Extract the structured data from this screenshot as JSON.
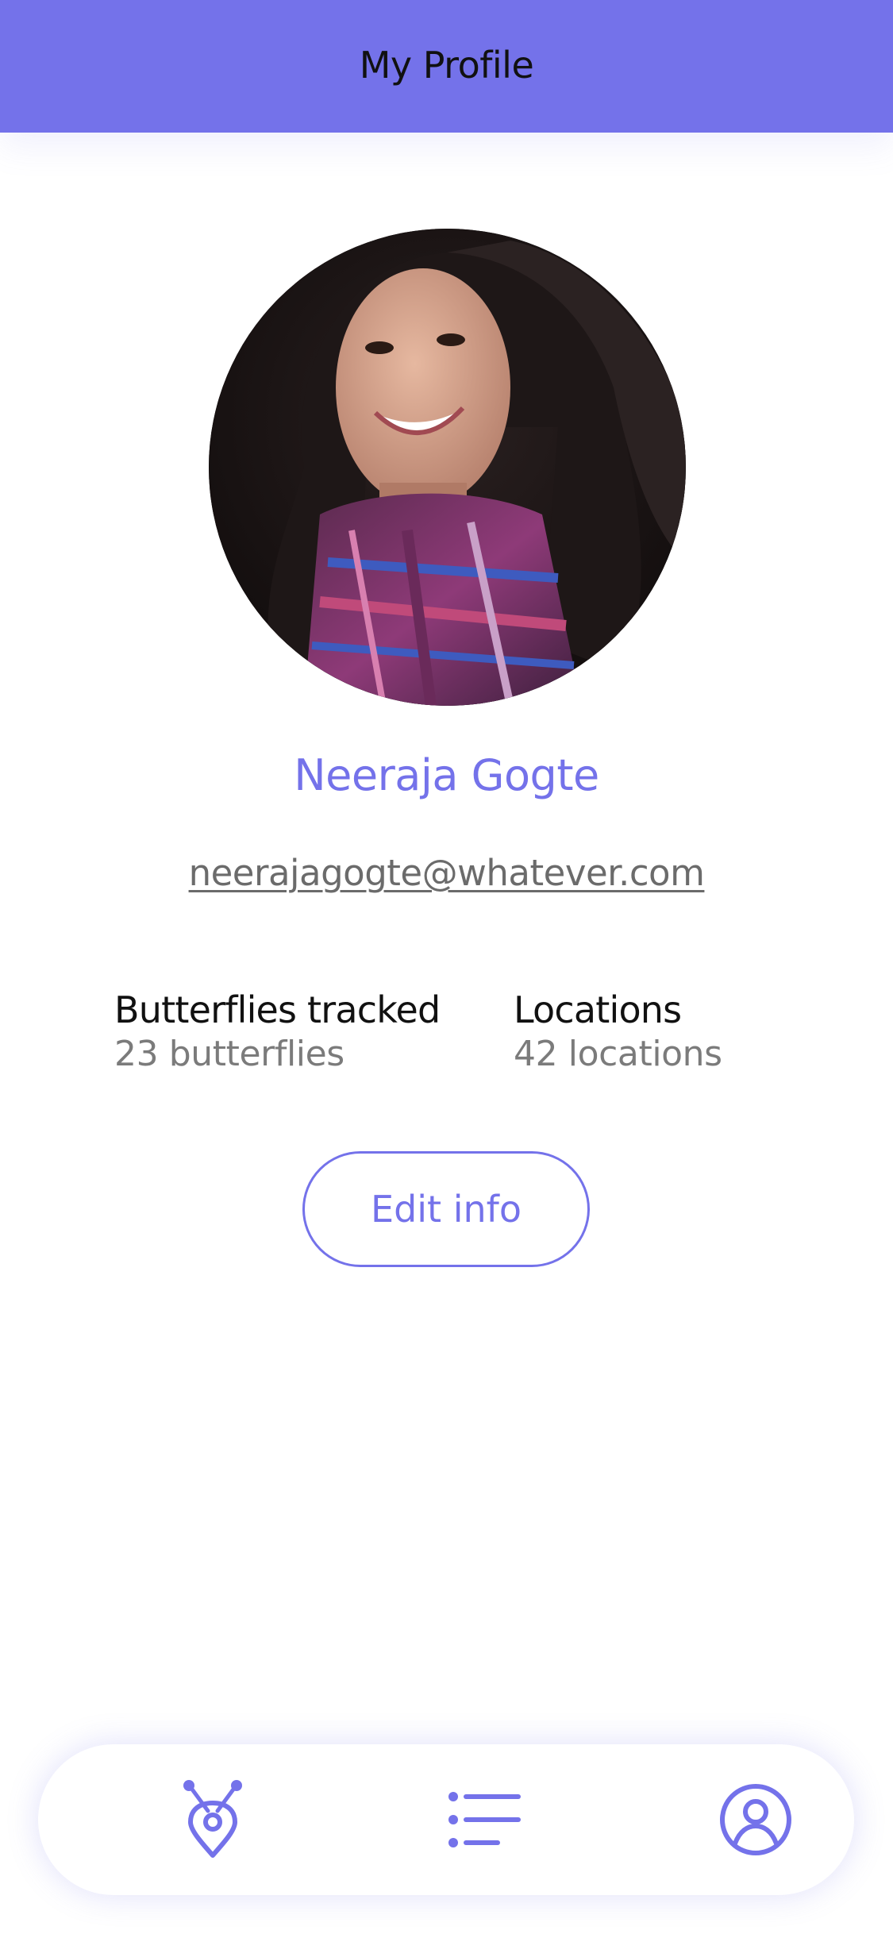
{
  "header": {
    "title": "My Profile"
  },
  "profile": {
    "name": "Neeraja Gogte",
    "email": "neerajagogte@whatever.com"
  },
  "stats": {
    "butterflies_label": "Butterflies tracked",
    "butterflies_value": "23 butterflies",
    "locations_label": "Locations",
    "locations_value": "42 locations"
  },
  "actions": {
    "edit_label": "Edit info"
  },
  "tabbar": {
    "items": [
      {
        "icon": "butterfly-location-icon"
      },
      {
        "icon": "list-icon"
      },
      {
        "icon": "user-icon"
      }
    ]
  },
  "colors": {
    "accent": "#7472ea",
    "text": "#111111",
    "muted": "#7b7b7b"
  }
}
